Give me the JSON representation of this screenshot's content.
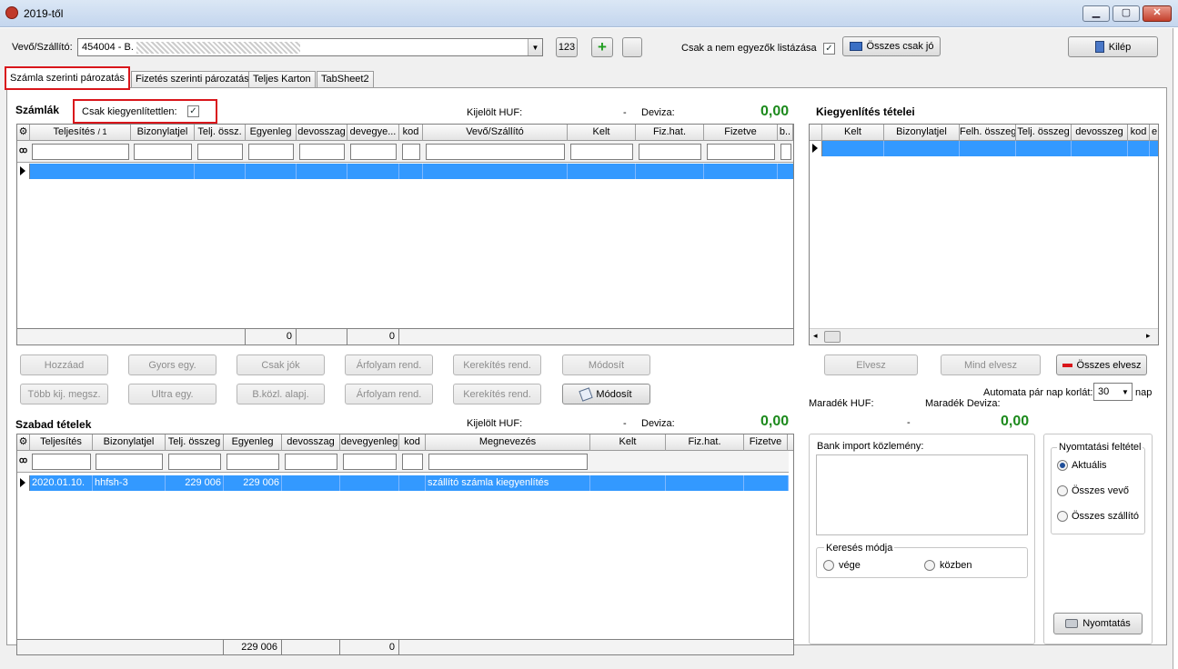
{
  "window": {
    "title": "2019-től"
  },
  "toolbar": {
    "vevo_label": "Vevő/Szállító:",
    "vevo_value": "454004 - B.",
    "btn_123": "123",
    "csak_nem_egyezok": "Csak a nem egyezők listázása",
    "osszes_csak_jo": "Összes csak jó",
    "kilep": "Kilép"
  },
  "tabs": [
    "Számla szerinti pározatás",
    "Fizetés szerinti pározatás",
    "Teljes Karton",
    "TabSheet2"
  ],
  "szamlak": {
    "title": "Számlák",
    "csak_kiegyenlitetlen": "Csak kiegyenlítettlen:",
    "kijelolt_huf_label": "Kijelölt HUF:",
    "kijelolt_huf_value": "-",
    "deviza_label": "Deviza:",
    "deviza_value": "0,00",
    "columns": [
      "Teljesítés",
      "Bizonylatjel",
      "Telj. össz.",
      "Egyenleg",
      "devosszag",
      "devegye...",
      "kod",
      "Vevő/Szállító",
      "Kelt",
      "Fiz.hat.",
      "Fizetve",
      "b.."
    ],
    "sort_mark": "/ 1",
    "footer": [
      "0",
      "0"
    ]
  },
  "kiegyenlites": {
    "title": "Kiegyenlítés tételei",
    "columns": [
      "Kelt",
      "Bizonylatjel",
      "Felh. összeg",
      "Telj. összeg",
      "devosszeg",
      "kod",
      "e"
    ]
  },
  "buttons_row1": [
    "Hozzáad",
    "Gyors egy.",
    "Csak jók",
    "Árfolyam rend.",
    "Kerekítés rend.",
    "Módosít"
  ],
  "buttons_row2": [
    "Több kij. megsz.",
    "Ultra egy.",
    "B.közl. alapj.",
    "Árfolyam rend.",
    "Kerekítés rend.",
    "Módosít"
  ],
  "right_buttons": [
    "Elvesz",
    "Mind elvesz",
    "Összes elvesz"
  ],
  "maradek": {
    "huf_label": "Maradék HUF:",
    "deviza_label": "Maradék Deviza:",
    "huf_value": "-",
    "deviza_value": "0,00",
    "automata_label": "Automata pár nap korlát:",
    "automata_value": "30",
    "nap": "nap"
  },
  "szabad": {
    "title": "Szabad tételek",
    "kijelolt_huf_label": "Kijelölt HUF:",
    "kijelolt_huf_value": "-",
    "deviza_label": "Deviza:",
    "deviza_value": "0,00",
    "columns": [
      "Teljesítés",
      "Bizonylatjel",
      "Telj. összeg",
      "Egyenleg",
      "devosszag",
      "devegyenleg",
      "kod",
      "Megnevezés",
      "Kelt",
      "Fiz.hat.",
      "Fizetve"
    ],
    "row": [
      "2020.01.10.",
      "hhfsh-3",
      "229 006",
      "229 006",
      "",
      "",
      "",
      "szállító számla kiegyenlítés",
      "",
      "",
      ""
    ],
    "footer": [
      "229 006",
      "0"
    ]
  },
  "bank": {
    "label": "Bank import közlemény:"
  },
  "kereses": {
    "title": "Keresés módja",
    "opt1": "vége",
    "opt2": "közben"
  },
  "nyomtatasi": {
    "title": "Nyomtatási feltétel",
    "opts": [
      "Aktuális",
      "Összes vevő",
      "Összes szállító"
    ],
    "print": "Nyomtatás"
  }
}
